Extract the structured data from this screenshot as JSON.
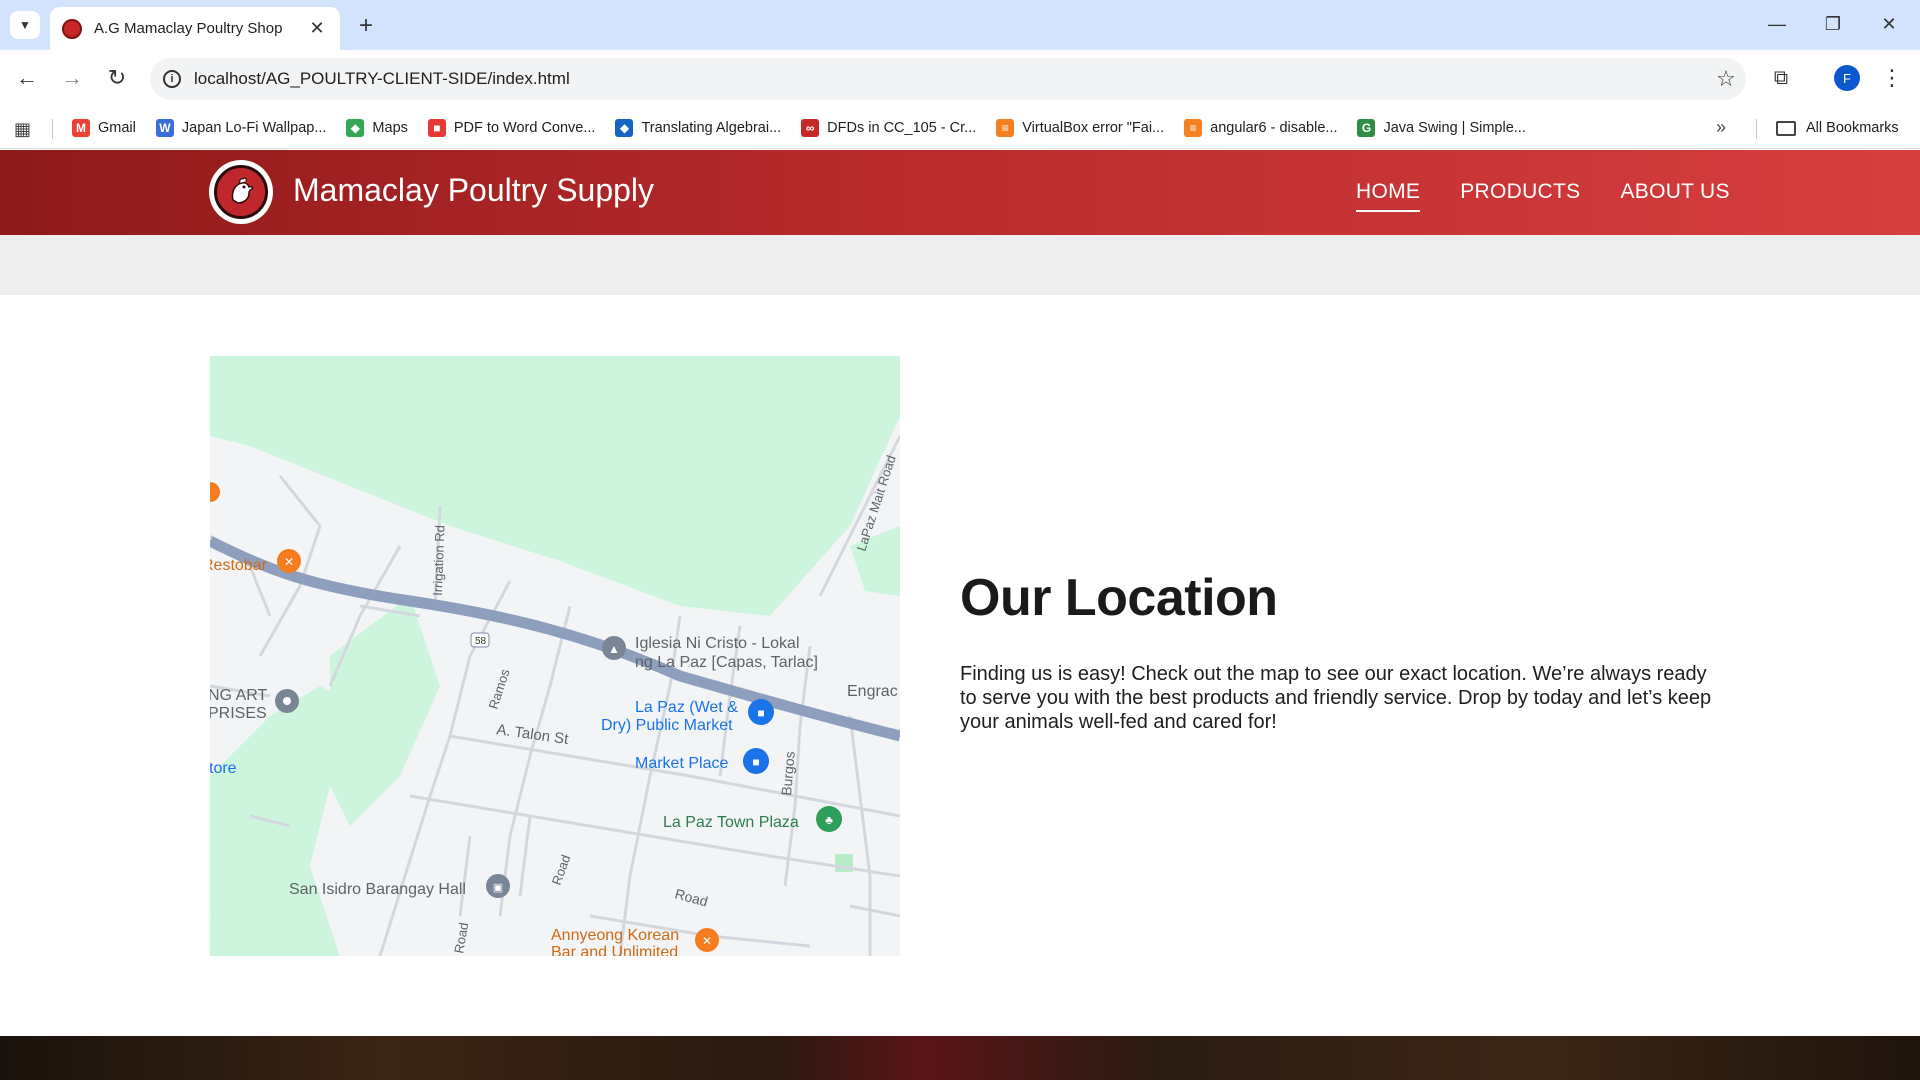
{
  "browser": {
    "tab_title": "A.G Mamaclay Poultry Shop",
    "url": "localhost/AG_POULTRY-CLIENT-SIDE/index.html",
    "profile_initial": "F",
    "bookmarks": [
      {
        "label": "Gmail",
        "icon": "gmail-icon",
        "color": "#ea4335",
        "glyph": "M"
      },
      {
        "label": "Japan Lo-Fi Wallpap...",
        "icon": "wallpaper-site-icon",
        "color": "#3b6fd6",
        "glyph": "W"
      },
      {
        "label": "Maps",
        "icon": "maps-icon",
        "color": "#34a853",
        "glyph": "◆"
      },
      {
        "label": "PDF to Word Conve...",
        "icon": "pdf-converter-icon",
        "color": "#e53935",
        "glyph": "■"
      },
      {
        "label": "Translating Algebrai...",
        "icon": "translate-site-icon",
        "color": "#1565c0",
        "glyph": "◆"
      },
      {
        "label": "DFDs in CC_105 - Cr...",
        "icon": "course-site-icon",
        "color": "#c62828",
        "glyph": "∞"
      },
      {
        "label": "VirtualBox error \"Fai...",
        "icon": "stackoverflow-icon",
        "color": "#f48024",
        "glyph": "≡"
      },
      {
        "label": "angular6 - disable...",
        "icon": "stackoverflow-icon",
        "color": "#f48024",
        "glyph": "≡"
      },
      {
        "label": "Java Swing | Simple...",
        "icon": "geeksforgeeks-icon",
        "color": "#2f8d46",
        "glyph": "G"
      }
    ],
    "all_bookmarks_label": "All Bookmarks"
  },
  "site": {
    "brand": "Mamaclay Poultry Supply",
    "nav": [
      "HOME",
      "PRODUCTS",
      "ABOUT US"
    ],
    "active_nav": "HOME"
  },
  "location": {
    "title": "Our Location",
    "text": "Finding us is easy! Check out the map to see our exact location. We’re always ready to serve you with the best products and friendly service. Drop by today and let’s keep your animals well-fed and cared for!"
  },
  "map": {
    "labels": {
      "restobar": "Restobar",
      "irrigation_rd": "Irrigation Rd",
      "lapaz_mait_road": "LaPaz Mait Road",
      "route_58": "58",
      "iglesia_1": "Iglesia Ni Cristo - Lokal",
      "iglesia_2": "ng La Paz [Capas, Tarlac]",
      "engrac": "Engrac",
      "ramos": "Ramos",
      "public_market_1": "La Paz (Wet &",
      "public_market_2": "Dry) Public Market",
      "ng_art": "NG ART",
      "prises": "PRISES",
      "a_talon_st": "A. Talon St",
      "market_place": "Market Place",
      "burgos": "Burgos",
      "store": "tore",
      "town_plaza": "La Paz Town Plaza",
      "barangay_hall": "San Isidro Barangay Hall",
      "road_1": "Road",
      "road_2": "Road",
      "road_3": "Road",
      "annyeong_1": "Annyeong Korean",
      "annyeong_2": "Bar and Unlimited"
    }
  }
}
